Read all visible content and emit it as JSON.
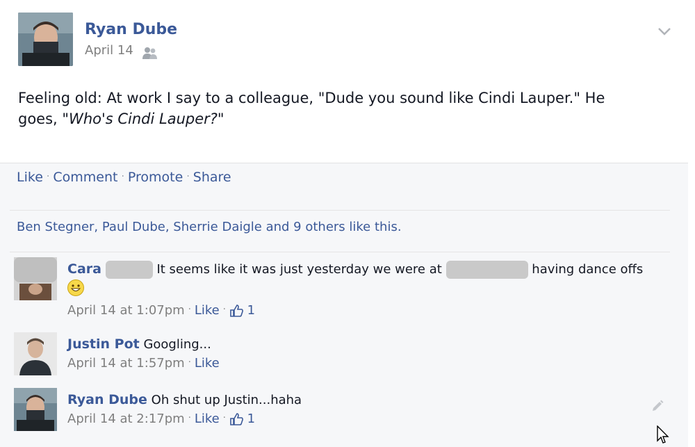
{
  "post": {
    "author": "Ryan Dube",
    "date": "April 14",
    "text_plain": "Feeling old: At work I say to a colleague, \"Dude you sound like Cindi Lauper.\" He goes, ",
    "text_italic": "\"Who's Cindi Lauper?\"",
    "icons": {
      "audience": "friends-icon",
      "menu": "chevron-down-icon"
    }
  },
  "actions": {
    "like": "Like",
    "comment": "Comment",
    "promote": "Promote",
    "share": "Share",
    "separator": "·"
  },
  "likes_summary": "Ben Stegner, Paul Dube, Sherrie Daigle and 9 others like this.",
  "comments": [
    {
      "author": "Cara",
      "text_before": "It seems like it was just yesterday we were at",
      "text_after": "having dance offs",
      "time": "April 14 at 1:07pm",
      "like": "Like",
      "like_count": "1",
      "has_emoji": true,
      "has_like_count": true
    },
    {
      "author": "Justin Pot",
      "text": "Googling...",
      "time": "April 14 at 1:57pm",
      "like": "Like"
    },
    {
      "author": "Ryan Dube",
      "text": "Oh shut up Justin...haha",
      "time": "April 14 at 2:17pm",
      "like": "Like",
      "like_count": "1"
    }
  ],
  "colors": {
    "link": "#3b5998",
    "meta": "#7f7f7f",
    "feedback_bg": "#f6f7f9",
    "text": "#141823"
  }
}
